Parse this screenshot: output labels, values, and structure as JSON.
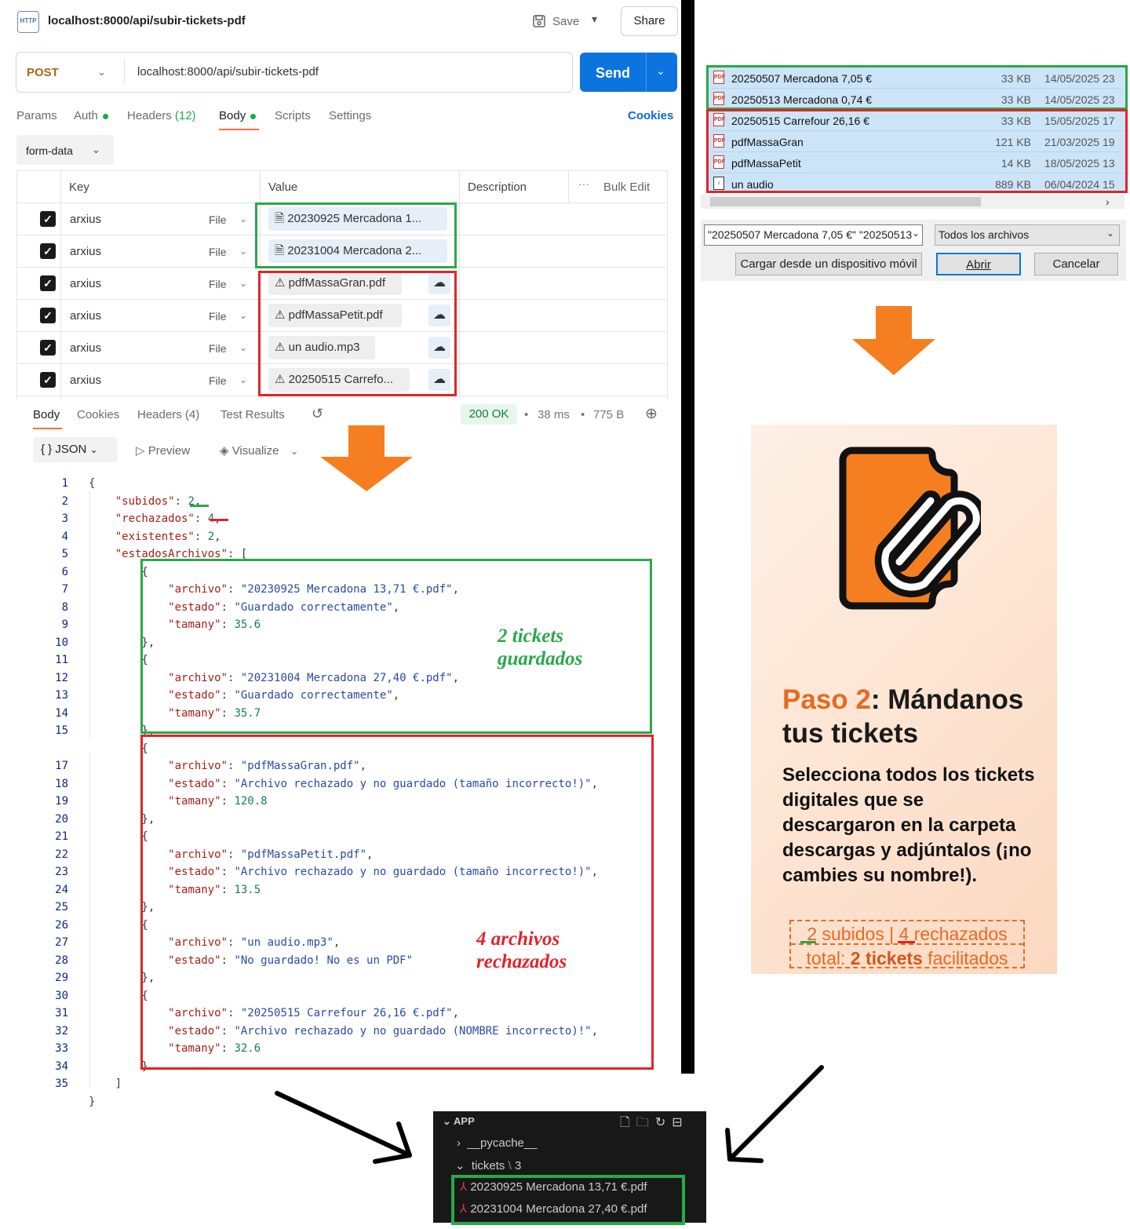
{
  "postman": {
    "request_title": "localhost:8000/api/subir-tickets-pdf",
    "http_icon_label": "HTTP",
    "save_label": "Save",
    "share_label": "Share",
    "method": "POST",
    "url": "localhost:8000/api/subir-tickets-pdf",
    "send_label": "Send",
    "tabs": {
      "params": "Params",
      "auth": "Auth",
      "headers": "Headers",
      "headers_count": "(12)",
      "body": "Body",
      "scripts": "Scripts",
      "settings": "Settings"
    },
    "cookies_label": "Cookies",
    "body_type": "form-data",
    "columns": {
      "key": "Key",
      "value": "Value",
      "description": "Description",
      "bulk_edit": "Bulk Edit"
    },
    "rows": [
      {
        "key": "arxius",
        "type": "File",
        "value": "20230925 Mercadona 1...",
        "status": "ok"
      },
      {
        "key": "arxius",
        "type": "File",
        "value": "20231004 Mercadona 2...",
        "status": "ok"
      },
      {
        "key": "arxius",
        "type": "File",
        "value": "pdfMassaGran.pdf",
        "status": "warn"
      },
      {
        "key": "arxius",
        "type": "File",
        "value": "pdfMassaPetit.pdf",
        "status": "warn"
      },
      {
        "key": "arxius",
        "type": "File",
        "value": "un audio.mp3",
        "status": "warn"
      },
      {
        "key": "arxius",
        "type": "File",
        "value": "20250515 Carrefo...",
        "status": "warn"
      }
    ],
    "response": {
      "tabs": {
        "body": "Body",
        "cookies": "Cookies",
        "headers": "Headers (4)",
        "test_results": "Test Results"
      },
      "status": "200 OK",
      "time": "38 ms",
      "size": "775 B",
      "format": "JSON",
      "preview": "Preview",
      "visualize": "Visualize"
    },
    "json_lines": [
      "{",
      "    \"subidos\": 2,",
      "    \"rechazados\": 4,",
      "    \"existentes\": 2,",
      "    \"estadosArchivos\": [",
      "        {",
      "            \"archivo\": \"20230925 Mercadona 13,71 €.pdf\",",
      "            \"estado\": \"Guardado correctamente\",",
      "            \"tamany\": 35.6",
      "        },",
      "        {",
      "            \"archivo\": \"20231004 Mercadona 27,40 €.pdf\",",
      "            \"estado\": \"Guardado correctamente\",",
      "            \"tamany\": 35.7",
      "        },",
      "        {",
      "            \"archivo\": \"pdfMassaGran.pdf\",",
      "            \"estado\": \"Archivo rechazado y no guardado (tamaño incorrecto!)\",",
      "            \"tamany\": 120.8",
      "        },",
      "        {",
      "            \"archivo\": \"pdfMassaPetit.pdf\",",
      "            \"estado\": \"Archivo rechazado y no guardado (tamaño incorrecto!)\",",
      "            \"tamany\": 13.5",
      "        },",
      "        {",
      "            \"archivo\": \"un audio.mp3\",",
      "            \"estado\": \"No guardado! No es un PDF\"",
      "        },",
      "        {",
      "            \"archivo\": \"20250515 Carrefour 26,16 €.pdf\",",
      "            \"estado\": \"Archivo rechazado y no guardado (NOMBRE incorrecto)!\",",
      "            \"tamany\": 32.6",
      "        }",
      "    ]",
      "}"
    ],
    "line_numbers_shown": 35
  },
  "annotations": {
    "saved_line1": "2 tickets",
    "saved_line2": "guardados",
    "rejected_line1": "4 archivos",
    "rejected_line2": "rechazados"
  },
  "file_dialog": {
    "files": [
      {
        "name": "20250507 Mercadona 7,05 €",
        "size": "33 KB",
        "date": "14/05/2025 23",
        "icon": "pdf-icon",
        "group": "ok"
      },
      {
        "name": "20250513 Mercadona 0,74 €",
        "size": "33 KB",
        "date": "14/05/2025 23",
        "icon": "pdf-icon",
        "group": "ok"
      },
      {
        "name": "20250515 Carrefour 26,16 €",
        "size": "33 KB",
        "date": "15/05/2025 17",
        "icon": "pdf-icon",
        "group": "bad"
      },
      {
        "name": "pdfMassaGran",
        "size": "121 KB",
        "date": "21/03/2025 19",
        "icon": "pdf-icon",
        "group": "bad"
      },
      {
        "name": "pdfMassaPetit",
        "size": "14 KB",
        "date": "18/05/2025 13",
        "icon": "pdf-icon",
        "group": "bad"
      },
      {
        "name": "un audio",
        "size": "889 KB",
        "date": "06/04/2024 15",
        "icon": "audio-icon",
        "group": "bad"
      }
    ],
    "filename_value": "\"20250507 Mercadona 7,05 €\" \"20250513",
    "filter": "Todos los archivos",
    "mobile_button": "Cargar desde un dispositivo móvil",
    "open_button": "Abrir",
    "cancel_button": "Cancelar"
  },
  "card": {
    "step": "Paso 2",
    "title_rest": ": Mándanos tus tickets",
    "description": "Selecciona todos los tickets digitales que se descargaron en la carpeta descargas y adjúntalos (¡no cambies su nombre!).",
    "uploaded_count": "2",
    "uploaded_label": "subidos |",
    "rejected_count": "4",
    "rejected_label": "rechazados",
    "total_label": "total:",
    "total_value": "2 tickets",
    "total_suffix": "facilitados",
    "icon": "ticket-paperclip-icon"
  },
  "explorer": {
    "root": "APP",
    "folders": [
      {
        "name": "__pycache__",
        "expanded": false
      },
      {
        "name": "tickets",
        "badge": "3",
        "expanded": true
      }
    ],
    "files": [
      "20230925 Mercadona 13,71 €.pdf",
      "20231004 Mercadona 27,40 €.pdf"
    ]
  },
  "colors": {
    "accent_orange": "#e66a22",
    "arrow_orange": "#f57f20",
    "ok_green": "#2aa84a",
    "bad_red": "#e1242a",
    "send_blue": "#0b74de"
  }
}
